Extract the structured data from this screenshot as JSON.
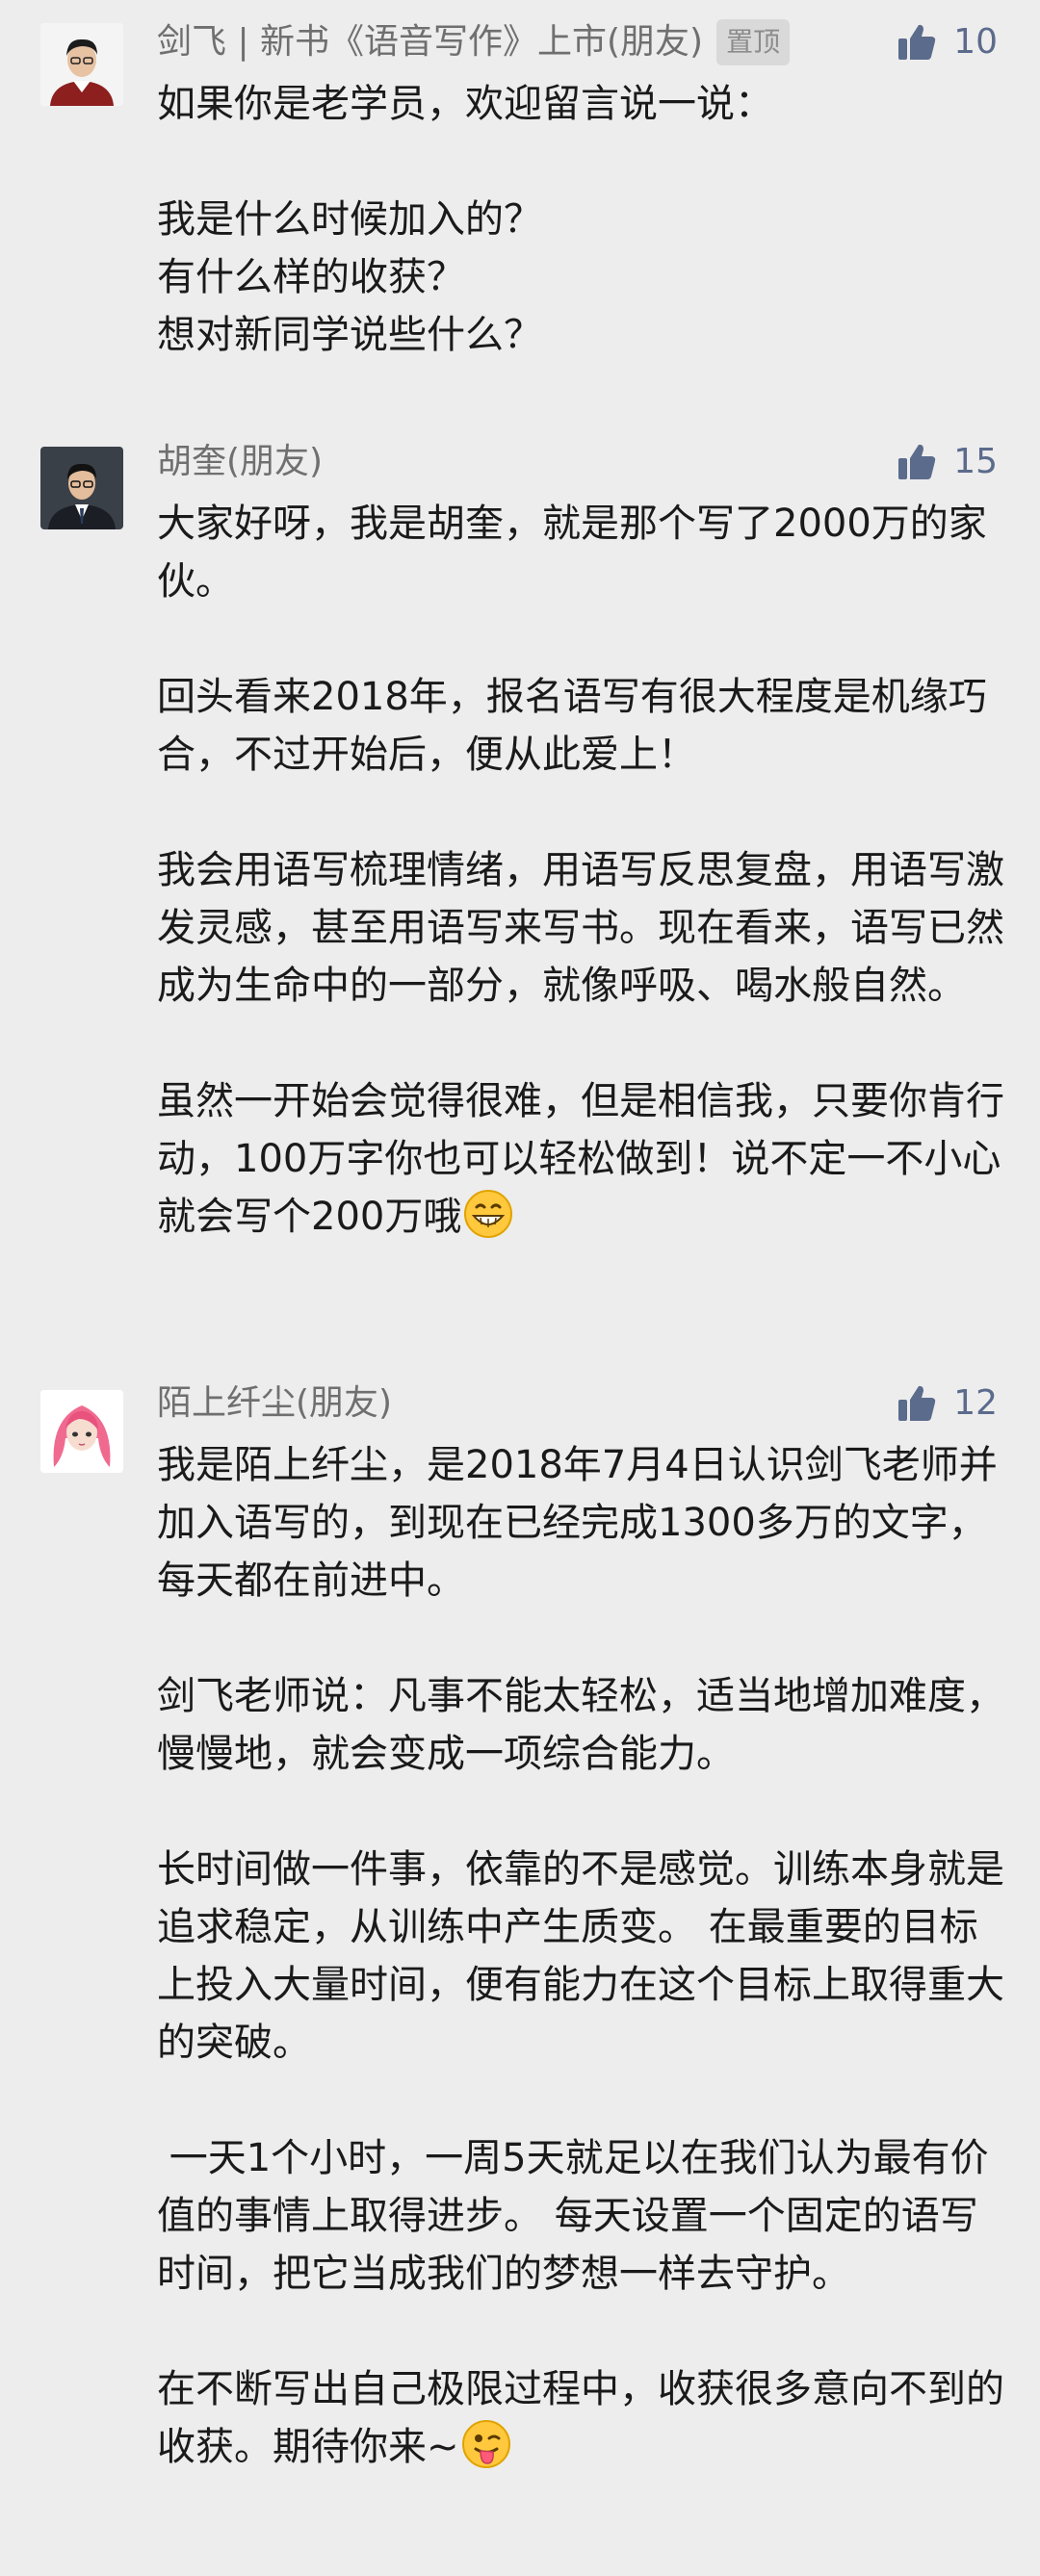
{
  "comments": [
    {
      "nickname": "剑飞 | 新书《语音写作》上市(朋友)",
      "pinned_label": "置顶",
      "likes": "10",
      "avatar_icon": "man-in-red-sweater-avatar",
      "body": "如果你是老学员，欢迎留言说一说：\n\n我是什么时候加入的？\n有什么样的收获？\n想对新同学说些什么？"
    },
    {
      "nickname": "胡奎(朋友)",
      "likes": "15",
      "avatar_icon": "man-in-suit-avatar",
      "body": "大家好呀，我是胡奎，就是那个写了2000万的家伙。\n\n回头看来2018年，报名语写有很大程度是机缘巧合，不过开始后，便从此爱上！\n\n我会用语写梳理情绪，用语写反思复盘，用语写激发灵感，甚至用语写来写书。现在看来，语写已然成为生命中的一部分，就像呼吸、喝水般自然。\n\n虽然一开始会觉得很难，但是相信我，只要你肯行动，100万字你也可以轻松做到！说不定一不小心就会写个200万哦",
      "emoji": "grinning-face-emoji"
    },
    {
      "nickname": "陌上纤尘(朋友)",
      "likes": "12",
      "avatar_icon": "pink-hair-girl-avatar",
      "body": "我是陌上纤尘，是2018年7月4日认识剑飞老师并加入语写的，到现在已经完成1300多万的文字，每天都在前进中。\n\n剑飞老师说：凡事不能太轻松，适当地增加难度，慢慢地，就会变成一项综合能力。\n\n长时间做一件事，依靠的不是感觉。训练本身就是追求稳定，从训练中产生质变。 在最重要的目标上投入大量时间，便有能力在这个目标上取得重大的突破。\n\n 一天1个小时，一周5天就足以在我们认为最有价值的事情上取得进步。 每天设置一个固定的语写时间，把它当成我们的梦想一样去守护。\n\n在不断写出自己极限过程中，收获很多意向不到的收获。期待你来~",
      "emoji": "winking-tongue-face-emoji"
    }
  ],
  "like_icon": "thumbs-up-icon",
  "colors": {
    "background": "#ededed",
    "nickname": "#6f6f6f",
    "like": "#5b6b8c",
    "text": "#1a1a1a"
  }
}
